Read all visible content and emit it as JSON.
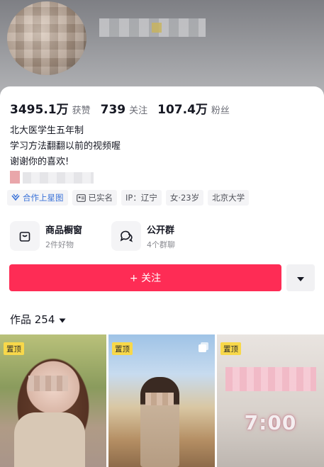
{
  "stats": [
    {
      "num": "3495.1万",
      "label": "获赞"
    },
    {
      "num": "739",
      "label": "关注"
    },
    {
      "num": "107.4万",
      "label": "粉丝"
    }
  ],
  "bio": {
    "line1": "北大医学生五年制",
    "line2": "学习方法翻翻以前的视频喔",
    "line3": "谢谢你的喜欢!"
  },
  "tags": [
    {
      "label": "合作上星图",
      "icon": "xingtu-icon"
    },
    {
      "label": "已实名",
      "icon": "id-card-icon"
    },
    {
      "label": "IP：辽宁",
      "icon": ""
    },
    {
      "label": "女·23岁",
      "icon": ""
    },
    {
      "label": "北京大学",
      "icon": ""
    }
  ],
  "shortcuts": [
    {
      "title": "商品橱窗",
      "sub": "2件好物",
      "icon": "shopping-bag-icon"
    },
    {
      "title": "公开群",
      "sub": "4个群聊",
      "icon": "chat-group-icon"
    }
  ],
  "follow": {
    "label": "+ 关注"
  },
  "works": {
    "label": "作品 254"
  },
  "tiles": [
    {
      "pin": "置顶"
    },
    {
      "pin": "置顶"
    },
    {
      "pin": "置顶",
      "overlay_text": "7:00"
    }
  ],
  "colors": {
    "accent": "#fe2c55",
    "pin": "#f8d84a",
    "tag_blue": "#3a72d8"
  }
}
